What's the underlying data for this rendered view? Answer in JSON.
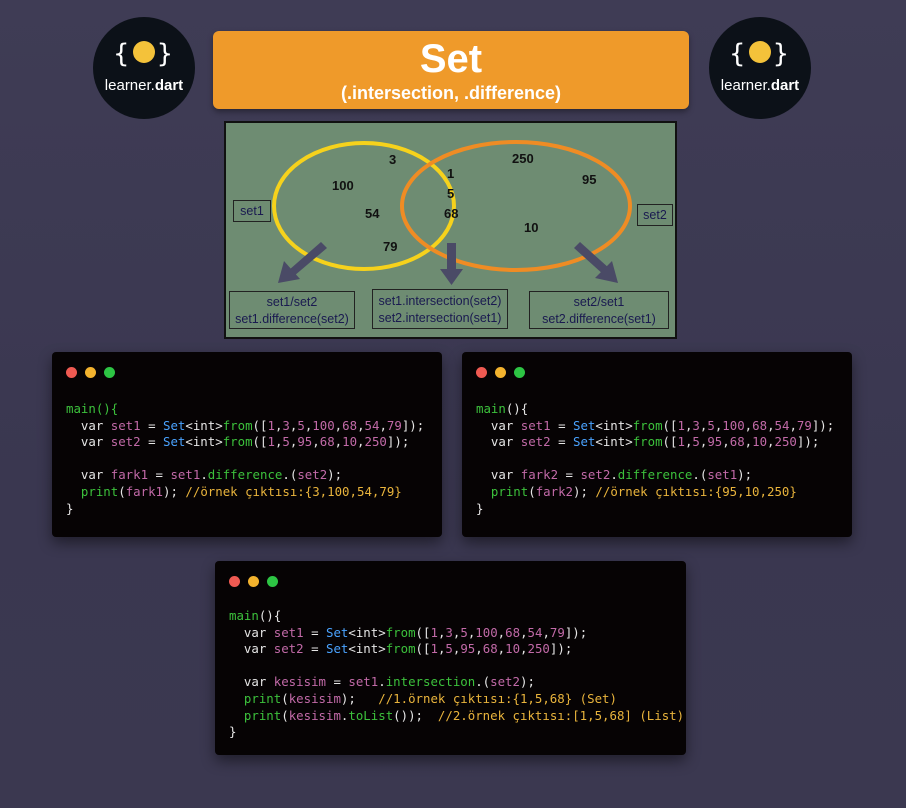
{
  "logo": {
    "braces_left": "{",
    "braces_right": "}",
    "text_plain": "learner.",
    "text_bold": "dart"
  },
  "banner": {
    "title": "Set",
    "subtitle": "(.intersection, .difference)"
  },
  "venn": {
    "set1_label": "set1",
    "set2_label": "set2",
    "only_set1": [
      "3",
      "100",
      "54",
      "79"
    ],
    "common": [
      "1",
      "5",
      "68"
    ],
    "only_set2": [
      "250",
      "95",
      "10"
    ],
    "box_left": [
      "set1/set2",
      "set1.difference(set2)"
    ],
    "box_mid": [
      "set1.intersection(set2)",
      "set2.intersection(set1)"
    ],
    "box_right": [
      "set2/set1",
      "set2.difference(set1)"
    ],
    "colors": {
      "set1": "#f6d21c",
      "set2": "#ef8c24",
      "arrow": "#4a4a66",
      "bg": "#6e8c72"
    }
  },
  "code1": {
    "lines": [
      "main(){",
      "  var set1 = Set<int>from([1,3,5,100,68,54,79]);",
      "  var set2 = Set<int>from([1,5,95,68,10,250]);",
      "",
      "  var fark1 = set1.difference.(set2);",
      "  print(fark1); //örnek çıktısı:{3,100,54,79}",
      "}"
    ]
  },
  "code2": {
    "lines": [
      "main(){",
      "  var set1 = Set<int>from([1,3,5,100,68,54,79]);",
      "  var set2 = Set<int>from([1,5,95,68,10,250]);",
      "",
      "  var fark2 = set2.difference.(set1);",
      "  print(fark2); //örnek çıktısı:{95,10,250}",
      "}"
    ]
  },
  "code3": {
    "lines": [
      "main(){",
      "  var set1 = Set<int>from([1,3,5,100,68,54,79]);",
      "  var set2 = Set<int>from([1,5,95,68,10,250]);",
      "",
      "  var kesisim = set1.intersection.(set2);",
      "  print(kesisim);   //1.örnek çıktısı:{1,5,68} (Set)",
      "  print(kesisim.toList());  //2.örnek çıktısı:[1,5,68] (List)",
      "}"
    ]
  }
}
